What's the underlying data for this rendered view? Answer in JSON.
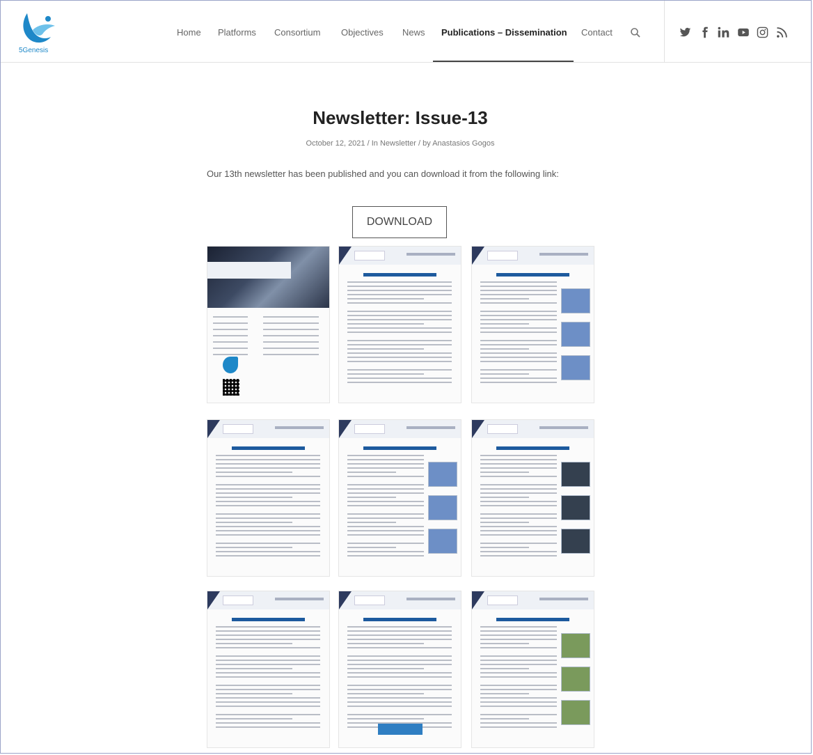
{
  "site": {
    "logo_text": "5Genesis"
  },
  "nav": {
    "items": [
      {
        "label": "Home"
      },
      {
        "label": "Platforms"
      },
      {
        "label": "Consortium"
      },
      {
        "label": "Objectives"
      },
      {
        "label": "News"
      },
      {
        "label": "Publications – Dissemination",
        "active": true
      },
      {
        "label": "Contact"
      }
    ],
    "social": [
      "twitter-icon",
      "facebook-icon",
      "linkedin-icon",
      "youtube-icon",
      "instagram-icon",
      "rss-icon"
    ]
  },
  "post": {
    "title": "Newsletter: Issue-13",
    "date": "October 12, 2021",
    "category": "In Newsletter",
    "author": "by Anastasios Gogos",
    "body": "Our 13th newsletter has been published and  you can download it from the following link:",
    "download_label": "DOWNLOAD"
  },
  "thumbnails": {
    "count": 9,
    "page_titles": [
      "5GENESIS Newsletter",
      "Dissemination and Communication Activities",
      "5GENESIS Newsletter",
      "White Papers",
      "Demonstration Video",
      "5G-PPP Activities",
      "Submitted Deliverables",
      "Upcoming Deliverables",
      "5GENESIS and 5GDrones Joint Trials"
    ]
  },
  "colors": {
    "navy": "#2d3a5e",
    "brand_blue": "#1e88c8",
    "text_dark": "#222222"
  }
}
